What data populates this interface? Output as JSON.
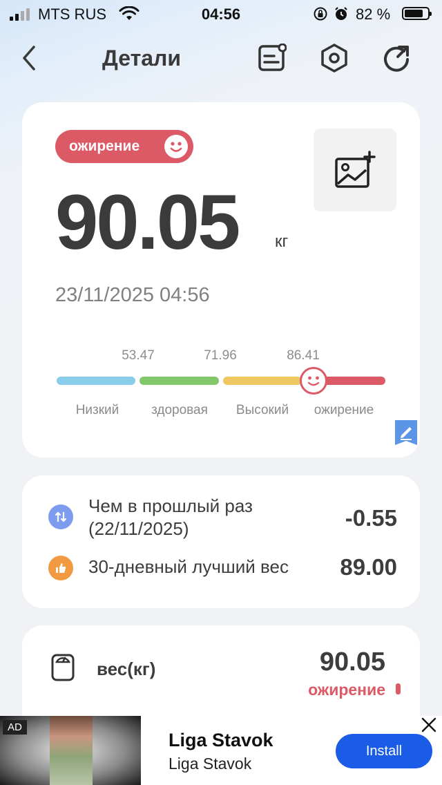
{
  "status_bar": {
    "carrier": "MTS RUS",
    "time": "04:56",
    "battery_percent": "82 %",
    "battery_level": 0.82
  },
  "nav": {
    "title": "Детали",
    "icons": [
      "back-icon",
      "note-icon",
      "settings-icon",
      "share-icon"
    ]
  },
  "main_card": {
    "badge": "ожирение",
    "weight": "90.05",
    "unit": "кг",
    "datetime": "23/11/2025 04:56",
    "thresholds": [
      "53.47",
      "71.96",
      "86.41"
    ],
    "categories": [
      "Низкий",
      "здоровая",
      "Высокий",
      "ожирение"
    ],
    "colors": {
      "low": "#8acdea",
      "healthy": "#82c76a",
      "high": "#efc763",
      "obese": "#dc5a66"
    }
  },
  "compare": {
    "last_label": "Чем в прошлый раз",
    "last_date": "(22/11/2025)",
    "last_value": "-0.55",
    "best_label": "30-дневный лучший вес",
    "best_value": "89.00"
  },
  "weight_row": {
    "label": "вес(кг)",
    "value": "90.05",
    "status": "ожирение"
  },
  "ad": {
    "tag": "AD",
    "title": "Liga Stavok",
    "subtitle": "Liga Stavok",
    "button": "Install"
  }
}
